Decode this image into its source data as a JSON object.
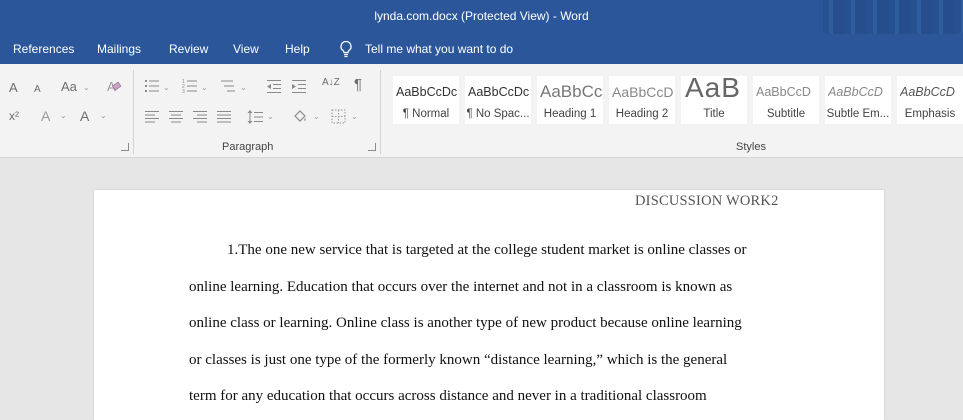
{
  "window": {
    "title": "lynda.com.docx (Protected View)  -  Word"
  },
  "menu": {
    "items": [
      "References",
      "Mailings",
      "Review",
      "View",
      "Help"
    ],
    "tell_me": "Tell me what you want to do"
  },
  "ribbon": {
    "paragraph_group_label": "Paragraph",
    "styles_group_label": "Styles",
    "font_glyphs": {
      "grow": "A",
      "shrink": "A",
      "case": "Aa",
      "superscript": "x²",
      "effects": "A",
      "color": "A"
    },
    "show_marks_glyph": "¶",
    "sort_glyph": "A↓Z",
    "styles": [
      {
        "sample": "AaBbCcDc",
        "name": "¶ Normal"
      },
      {
        "sample": "AaBbCcDc",
        "name": "¶ No Spac..."
      },
      {
        "sample": "AaBbCc",
        "name": "Heading 1"
      },
      {
        "sample": "AaBbCcD",
        "name": "Heading 2"
      },
      {
        "sample": "AaB",
        "name": "Title"
      },
      {
        "sample": "AaBbCcD",
        "name": "Subtitle"
      },
      {
        "sample": "AaBbCcD",
        "name": "Subtle Em..."
      },
      {
        "sample": "AaBbCcD",
        "name": "Emphasis"
      }
    ]
  },
  "document": {
    "header": "DISCUSSION WORK2",
    "lines": [
      "1.The one new service that is targeted at the college student market is online classes or",
      "online learning.  Education that occurs over the internet and not in a classroom is known as",
      "online class or learning.  Online class is another type of new product because online learning",
      "or classes is just one type of the formerly known “distance learning,” which is the general",
      "term for any education that occurs across distance and never in a traditional classroom"
    ]
  }
}
